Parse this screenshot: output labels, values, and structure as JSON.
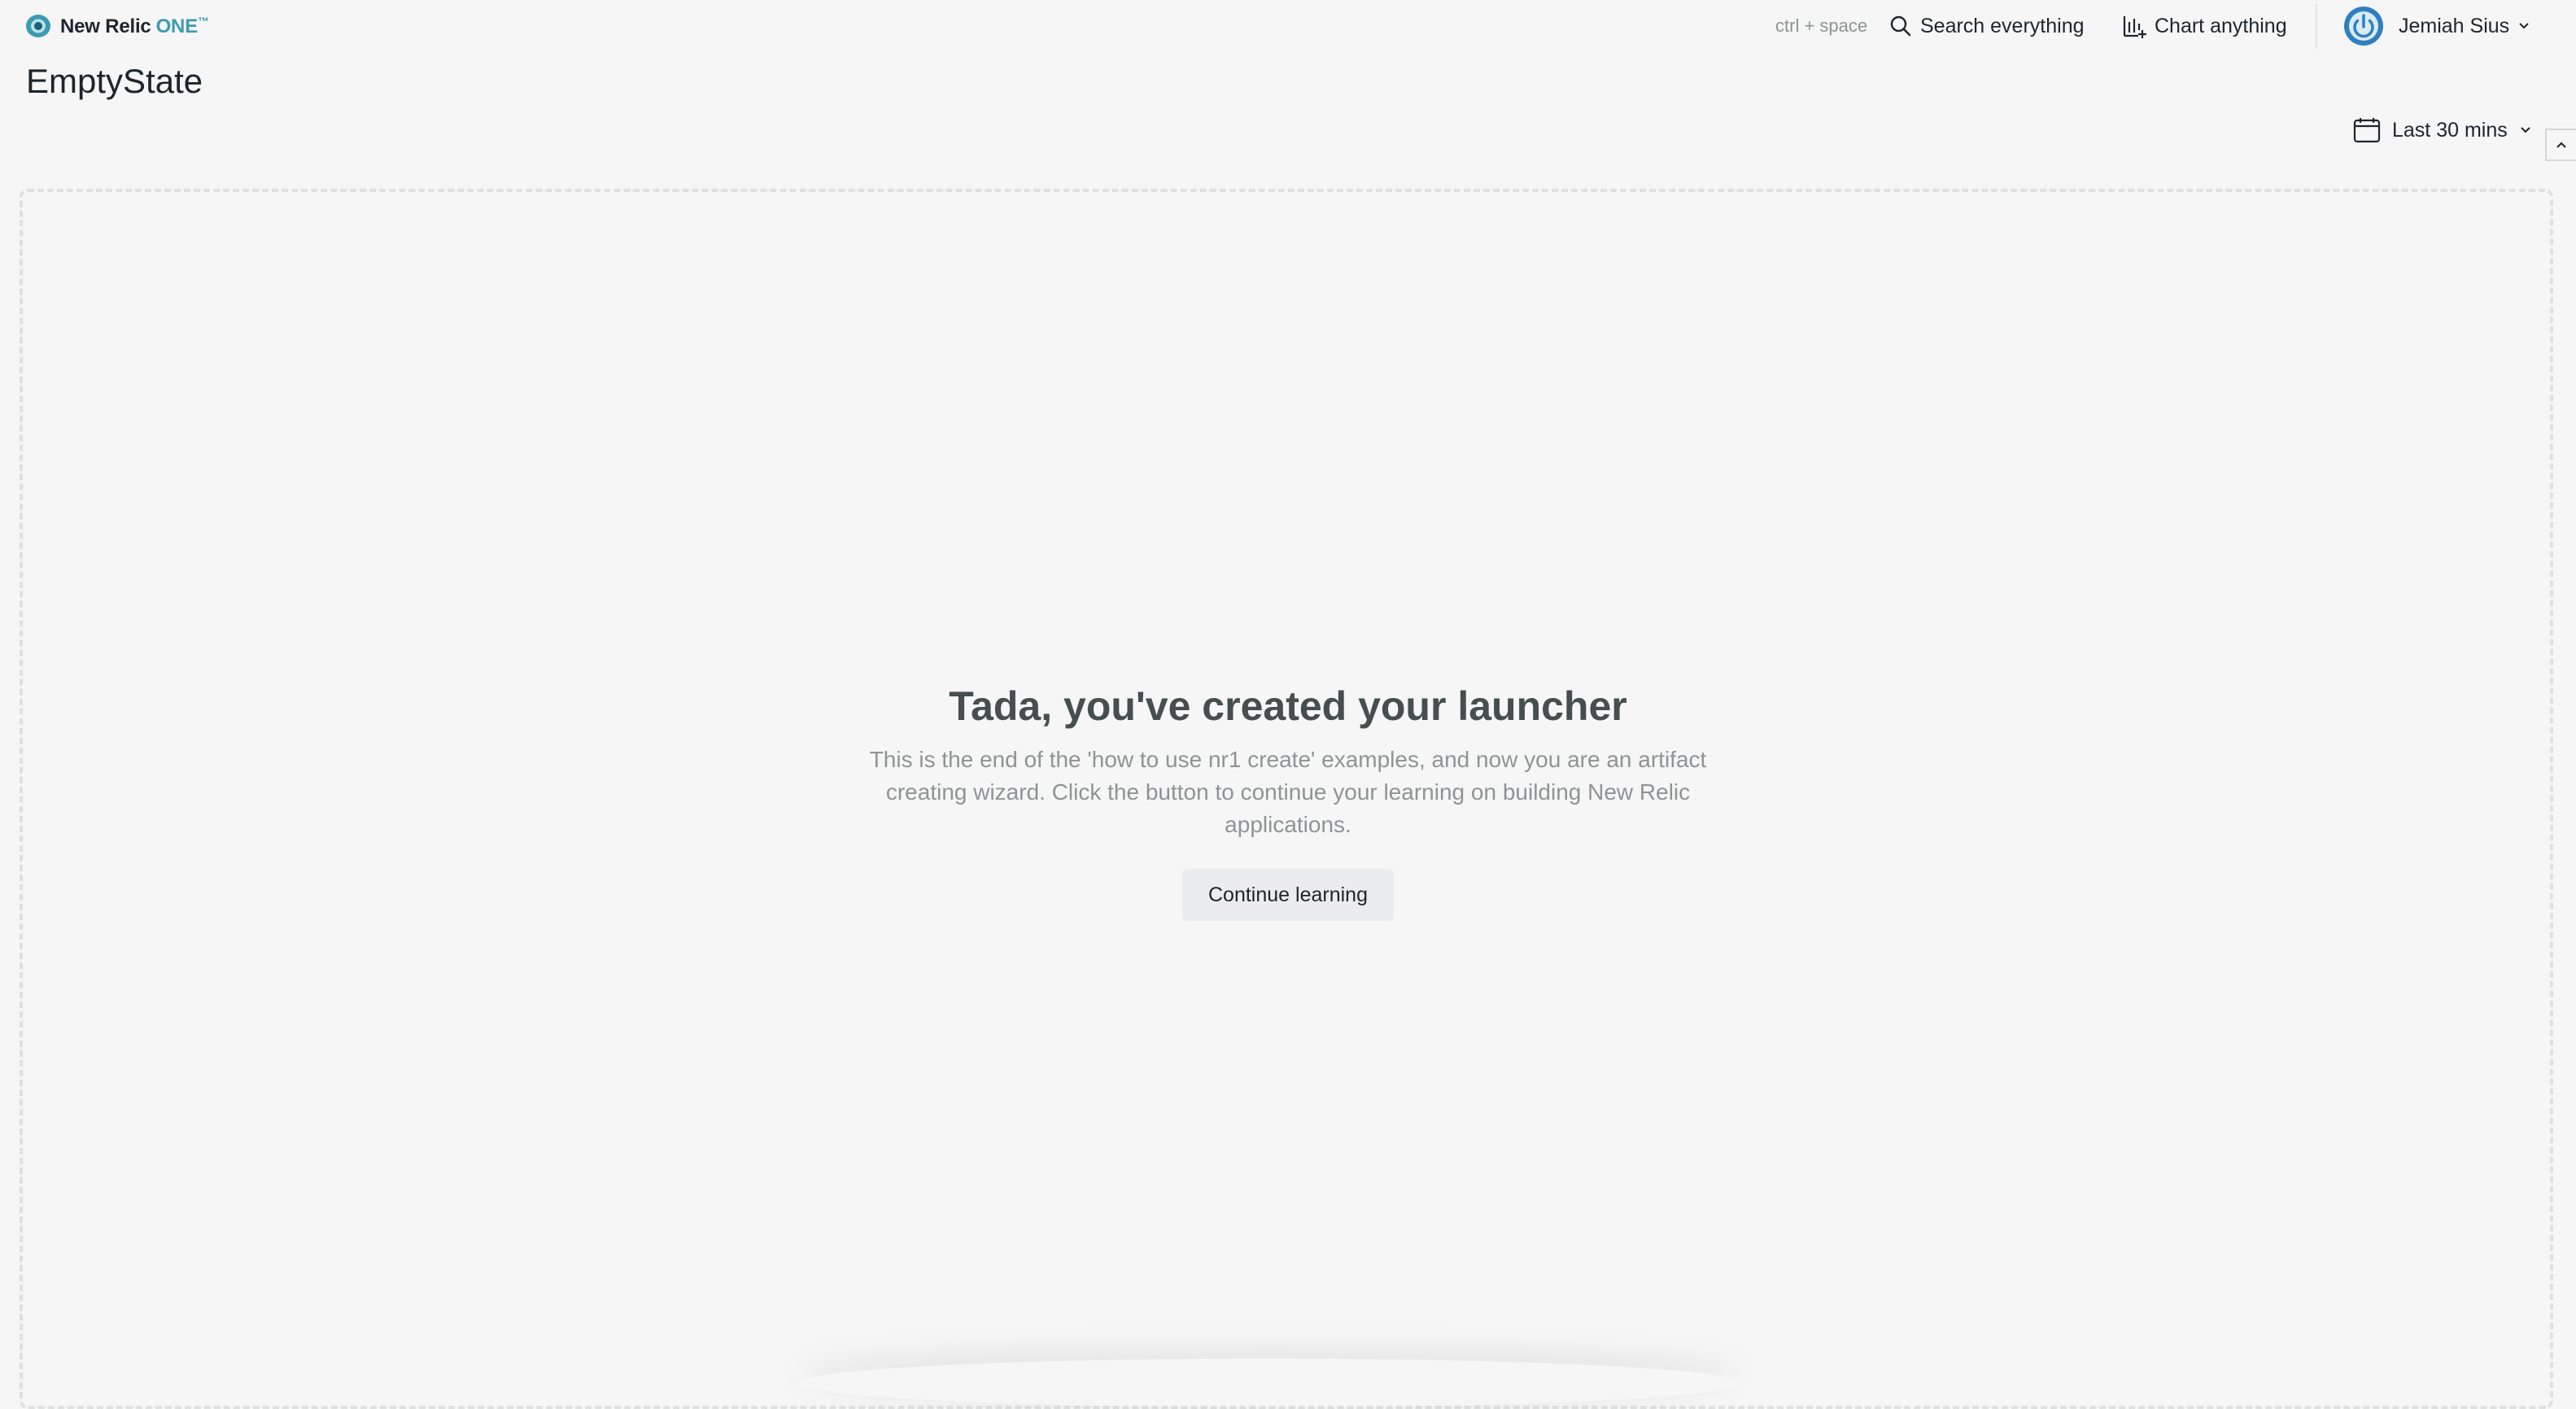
{
  "brand": {
    "name": "New Relic",
    "product": "ONE",
    "trademark": "™",
    "accent": "#3c9bb2"
  },
  "topbar": {
    "shortcut_hint": "ctrl + space",
    "search_label": "Search everything",
    "chart_label": "Chart anything",
    "user_name": "Jemiah Sius",
    "avatar_color": "#2f7fc1"
  },
  "page": {
    "title": "EmptyState"
  },
  "time_picker": {
    "label": "Last 30 mins"
  },
  "empty_state": {
    "heading": "Tada, you've created your launcher",
    "description": "This is the end of the 'how to use nr1 create' examples, and now you are an artifact creating wizard. Click the button to continue your learning on building New Relic applications.",
    "button_label": "Continue learning"
  }
}
